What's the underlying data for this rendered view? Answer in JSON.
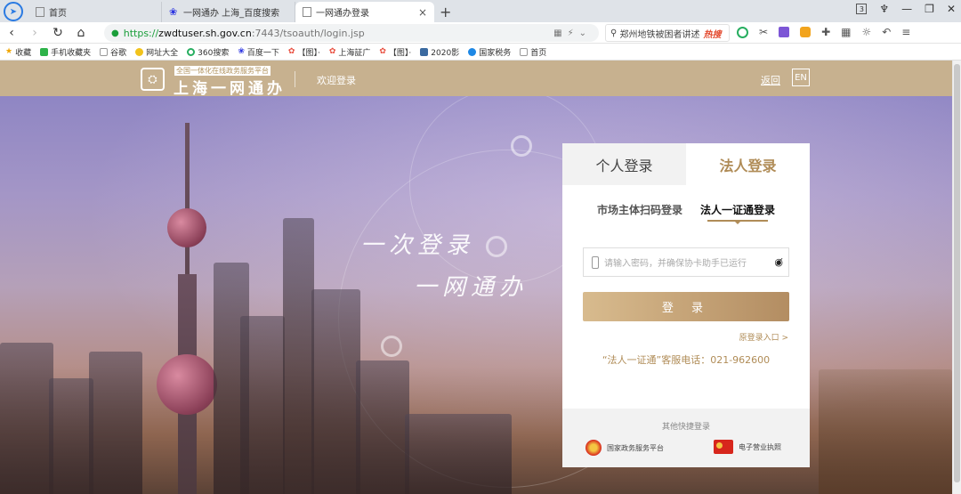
{
  "browser": {
    "tabs": [
      {
        "title": "首页"
      },
      {
        "title": "一网通办 上海_百度搜索"
      },
      {
        "title": "一网通办登录",
        "active": true
      }
    ],
    "url": {
      "scheme": "https://",
      "host": "zwdtuser.sh.gov.cn",
      "path": ":7443/tsoauth/login.jsp"
    },
    "search_text": "郑州地铁被困者讲述",
    "search_hot": "热搜",
    "bookmarks": [
      "收藏",
      "手机收藏夹",
      "谷歌",
      "网址大全",
      "360搜索",
      "百度一下",
      "【图】·",
      "上海証广",
      "【图】·",
      "2020影",
      "国家税务",
      "首页"
    ]
  },
  "header": {
    "logo_tagline": "全国一体化在线政务服务平台",
    "logo_title": "上海一网通办",
    "welcome": "欢迎登录",
    "back": "返回",
    "lang": "EN"
  },
  "hero": {
    "slogan_1": "一次登录",
    "slogan_2": "一网通办"
  },
  "login": {
    "tab_personal": "个人登录",
    "tab_legal": "法人登录",
    "sub_scan": "市场主体扫码登录",
    "sub_cert": "法人一证通登录",
    "password_placeholder": "请输入密码，并确保协卡助手已运行",
    "button": "登 录",
    "old_entry": "原登录入口 >",
    "hotline": "“法人一证通”客服电话：021-962600",
    "quick_title": "其他快捷登录",
    "quick_gov": "国家政务服务平台",
    "quick_license": "电子营业执照"
  }
}
